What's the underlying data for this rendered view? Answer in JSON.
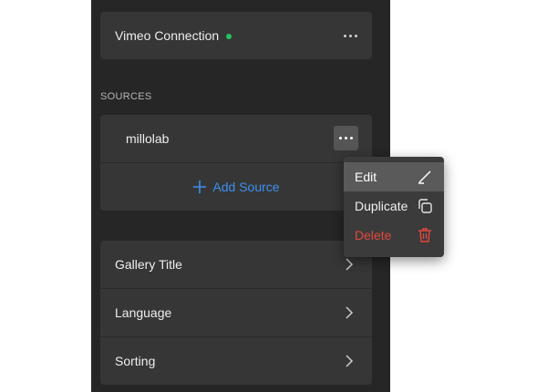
{
  "vimeo": {
    "label": "Vimeo Connection",
    "status_color": "#22c55e",
    "more_icon": "more-horizontal-icon"
  },
  "sources": {
    "section_label": "SOURCES",
    "items": [
      {
        "label": "millolab",
        "more_icon": "more-horizontal-icon"
      }
    ],
    "add_label": "Add Source",
    "add_icon": "plus-icon",
    "accent_color": "#3d8ff0"
  },
  "context_menu": {
    "items": [
      {
        "label": "Edit",
        "icon": "pencil-icon"
      },
      {
        "label": "Duplicate",
        "icon": "copy-icon"
      },
      {
        "label": "Delete",
        "icon": "trash-icon",
        "color": "#e0483e"
      }
    ]
  },
  "settings": {
    "items": [
      {
        "label": "Gallery Title",
        "icon": "chevron-right-icon"
      },
      {
        "label": "Language",
        "icon": "chevron-right-icon"
      },
      {
        "label": "Sorting",
        "icon": "chevron-right-icon"
      }
    ]
  }
}
